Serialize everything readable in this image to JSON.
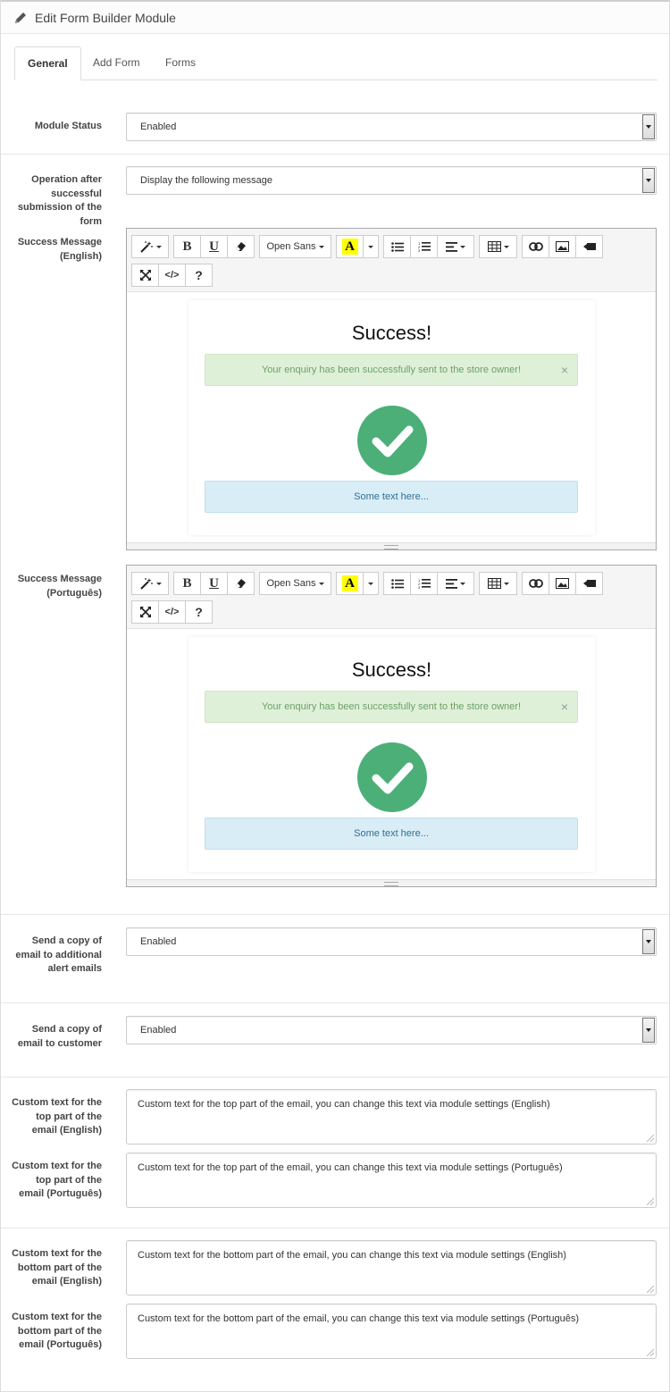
{
  "header": {
    "title": "Edit Form Builder Module",
    "icon": "pencil-icon"
  },
  "tabs": [
    {
      "label": "General",
      "active": true
    },
    {
      "label": "Add Form",
      "active": false
    },
    {
      "label": "Forms",
      "active": false
    }
  ],
  "fields": {
    "module_status": {
      "label": "Module Status",
      "value": "Enabled"
    },
    "operation": {
      "label": "Operation after successful submission of the form",
      "value": "Display the following message"
    },
    "success_en": {
      "label": "Success Message (English)"
    },
    "success_pt": {
      "label": "Success Message (Português)"
    },
    "copy_alert": {
      "label": "Send a copy of email to additional alert emails",
      "value": "Enabled"
    },
    "copy_customer": {
      "label": "Send a copy of email to customer",
      "value": "Enabled"
    },
    "top_en": {
      "label": "Custom text for the top part of the email (English)",
      "value": "Custom text for the top part of the email, you can change this text via module settings (English)"
    },
    "top_pt": {
      "label": "Custom text for the top part of the email (Português)",
      "value": "Custom text for the top part of the email, you can change this text via module settings (Português)"
    },
    "bottom_en": {
      "label": "Custom text for the bottom part of the email (English)",
      "value": "Custom text for the bottom part of the email, you can change this text via module settings (English)"
    },
    "bottom_pt": {
      "label": "Custom text for the bottom part of the email (Português)",
      "value": "Custom text for the bottom part of the email, you can change this text via module settings (Português)"
    }
  },
  "editor": {
    "font_name": "Open Sans",
    "bold": "B",
    "underline": "U",
    "color_letter": "A",
    "code": "</>",
    "help": "?",
    "content": {
      "heading": "Success!",
      "alert_text": "Your enquiry has been successfully sent to the store owner!",
      "close": "×",
      "info_text": "Some text here..."
    }
  },
  "colors": {
    "success_bg": "#dff0d8",
    "success_text": "#6ca16a",
    "info_bg": "#d9edf7",
    "info_text": "#31708f",
    "check_circle": "#4caf78",
    "highlight": "#ffff00"
  }
}
